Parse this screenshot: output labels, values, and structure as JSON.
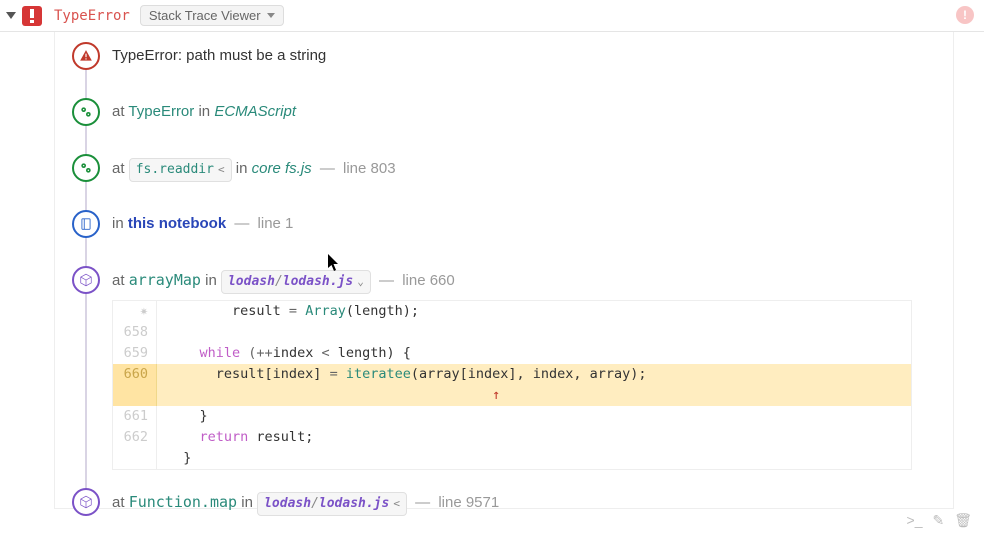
{
  "header": {
    "error_type": "TypeError",
    "viewer_label": "Stack Trace Viewer"
  },
  "frames": [
    {
      "kind": "error",
      "message": "TypeError: path must be a string"
    },
    {
      "kind": "gear",
      "at": "at",
      "fn": "TypeError",
      "in": "in",
      "src": "ECMAScript"
    },
    {
      "kind": "gear",
      "at": "at",
      "pill_fn": "fs.readdir",
      "pill_chev": "<",
      "in": "in",
      "src_prefix": "core",
      "src_file": "fs.js",
      "line_label": "line 803"
    },
    {
      "kind": "book",
      "in": "in",
      "notebook": "this notebook",
      "line_label": "line 1"
    },
    {
      "kind": "pkg",
      "at": "at",
      "fn": "arrayMap",
      "in": "in",
      "path_pkg": "lodash",
      "path_file": "lodash.js",
      "pill_chev": "⌄",
      "line_label": "line 660"
    },
    {
      "kind": "pkg",
      "at": "at",
      "fn": "Function.map",
      "in": "in",
      "path_pkg": "lodash",
      "path_file": "lodash.js",
      "pill_chev": "<",
      "line_label": "line 9571"
    }
  ],
  "code": {
    "snow_glyph": "✷",
    "rows": [
      {
        "n": "",
        "snow": true,
        "segs": [
          {
            "t": "        result ",
            "c": "tok-id"
          },
          {
            "t": "= ",
            "c": "tok-op"
          },
          {
            "t": "Array",
            "c": "tok-call"
          },
          {
            "t": "(length);",
            "c": "tok-id"
          }
        ]
      },
      {
        "n": "658",
        "segs": [
          {
            "t": "",
            "c": ""
          }
        ]
      },
      {
        "n": "659",
        "segs": [
          {
            "t": "    ",
            "c": ""
          },
          {
            "t": "while",
            "c": "tok-kw"
          },
          {
            "t": " (",
            "c": "tok-op"
          },
          {
            "t": "++",
            "c": "tok-op"
          },
          {
            "t": "index ",
            "c": "tok-id"
          },
          {
            "t": "< ",
            "c": "tok-op"
          },
          {
            "t": "length) {",
            "c": "tok-id"
          }
        ]
      },
      {
        "n": "660",
        "hl": true,
        "segs": [
          {
            "t": "      result[index] ",
            "c": "tok-id"
          },
          {
            "t": "= ",
            "c": "tok-op"
          },
          {
            "t": "iteratee",
            "c": "tok-call"
          },
          {
            "t": "(array[index], index, array);",
            "c": "tok-id"
          }
        ]
      },
      {
        "n": "",
        "hl": true,
        "caret": true,
        "caret_pad": "                                        ",
        "caret_sym": "↑"
      },
      {
        "n": "661",
        "segs": [
          {
            "t": "    }",
            "c": "tok-id"
          }
        ]
      },
      {
        "n": "662",
        "segs": [
          {
            "t": "    ",
            "c": ""
          },
          {
            "t": "return",
            "c": "tok-kw"
          },
          {
            "t": " result;",
            "c": "tok-id"
          }
        ]
      },
      {
        "n": "",
        "segs": [
          {
            "t": "  }",
            "c": "tok-id"
          }
        ]
      }
    ]
  },
  "footer": {
    "terminal": ">_",
    "edit": "✎",
    "trash": "🗑"
  }
}
